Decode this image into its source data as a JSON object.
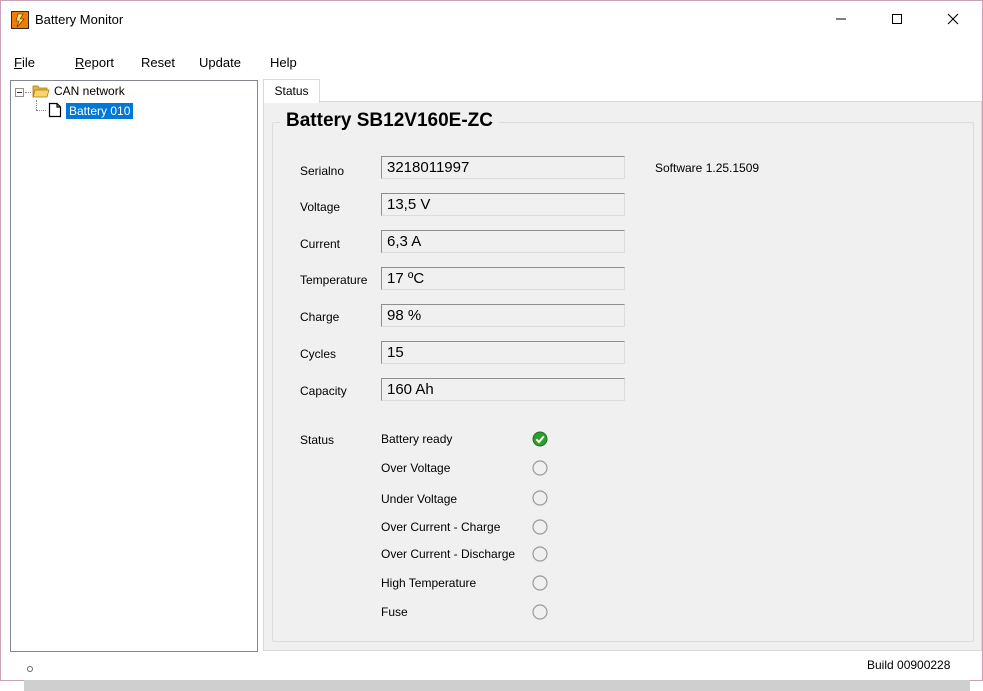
{
  "window": {
    "title": "Battery Monitor"
  },
  "menu": [
    {
      "label": "File",
      "mnemonic": "F",
      "rest": "ile"
    },
    {
      "label": "Report",
      "mnemonic": "R",
      "rest": "eport"
    },
    {
      "label": "Reset"
    },
    {
      "label": "Update"
    },
    {
      "label": "Help"
    }
  ],
  "tree": {
    "root": {
      "label": "CAN network",
      "icon": "folder-open-icon"
    },
    "children": [
      {
        "label": "Battery 010",
        "icon": "document-icon",
        "selected": true
      }
    ]
  },
  "tabs": [
    {
      "label": "Status",
      "active": true
    }
  ],
  "battery": {
    "title": "Battery SB12V160E-ZC",
    "software": "Software 1.25.1509",
    "fields": [
      {
        "label": "Serialno",
        "value": "3218011997"
      },
      {
        "label": "Voltage",
        "value": "13,5 V"
      },
      {
        "label": "Current",
        "value": "6,3 A"
      },
      {
        "label": "Temperature",
        "value": "17 ºC"
      },
      {
        "label": "Charge",
        "value": "98 %"
      },
      {
        "label": "Cycles",
        "value": "15"
      },
      {
        "label": "Capacity",
        "value": "160 Ah"
      }
    ],
    "status_heading": "Status",
    "statuses": [
      {
        "label": "Battery ready",
        "active": true
      },
      {
        "label": "Over Voltage",
        "active": false
      },
      {
        "label": "Under Voltage",
        "active": false
      },
      {
        "label": "Over Current - Charge",
        "active": false
      },
      {
        "label": "Over Current - Discharge",
        "active": false
      },
      {
        "label": "High Temperature",
        "active": false
      },
      {
        "label": "Fuse",
        "active": false
      }
    ]
  },
  "statusbar": {
    "build": "Build 00900228"
  },
  "colors": {
    "selection": "#0078d7",
    "ok_green": "#2e9e2e",
    "panel_bg": "#f0f0f0"
  }
}
